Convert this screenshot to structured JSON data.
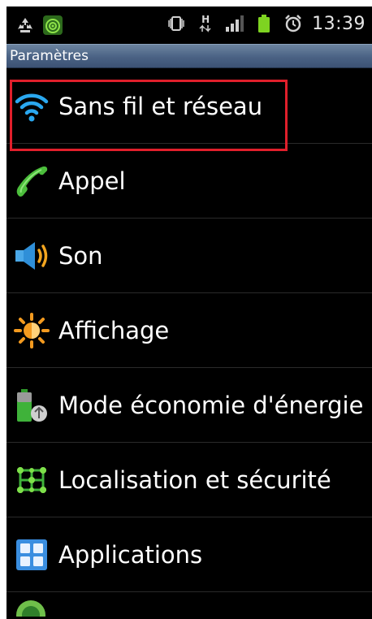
{
  "status_bar": {
    "time": "13:39",
    "network_type": "H",
    "left_icons": [
      "recycle-icon",
      "lookout-shield-icon"
    ],
    "right_icons": [
      "vibrate-icon",
      "data-arrows-icon",
      "signal-bars-icon",
      "battery-icon",
      "alarm-clock-icon"
    ]
  },
  "header": {
    "title": "Paramètres"
  },
  "settings": {
    "items": [
      {
        "label": "Sans fil et réseau",
        "icon": "wifi-icon"
      },
      {
        "label": "Appel",
        "icon": "phone-handset-icon"
      },
      {
        "label": "Son",
        "icon": "speaker-icon"
      },
      {
        "label": "Affichage",
        "icon": "brightness-icon"
      },
      {
        "label": "Mode économie d'énergie",
        "icon": "battery-recycle-icon"
      },
      {
        "label": "Localisation et sécurité",
        "icon": "location-grid-icon"
      },
      {
        "label": "Applications",
        "icon": "apps-grid-icon"
      }
    ]
  },
  "colors": {
    "highlight_border": "#e01f2b",
    "titlebar": "#4a6284",
    "background": "#000000"
  }
}
